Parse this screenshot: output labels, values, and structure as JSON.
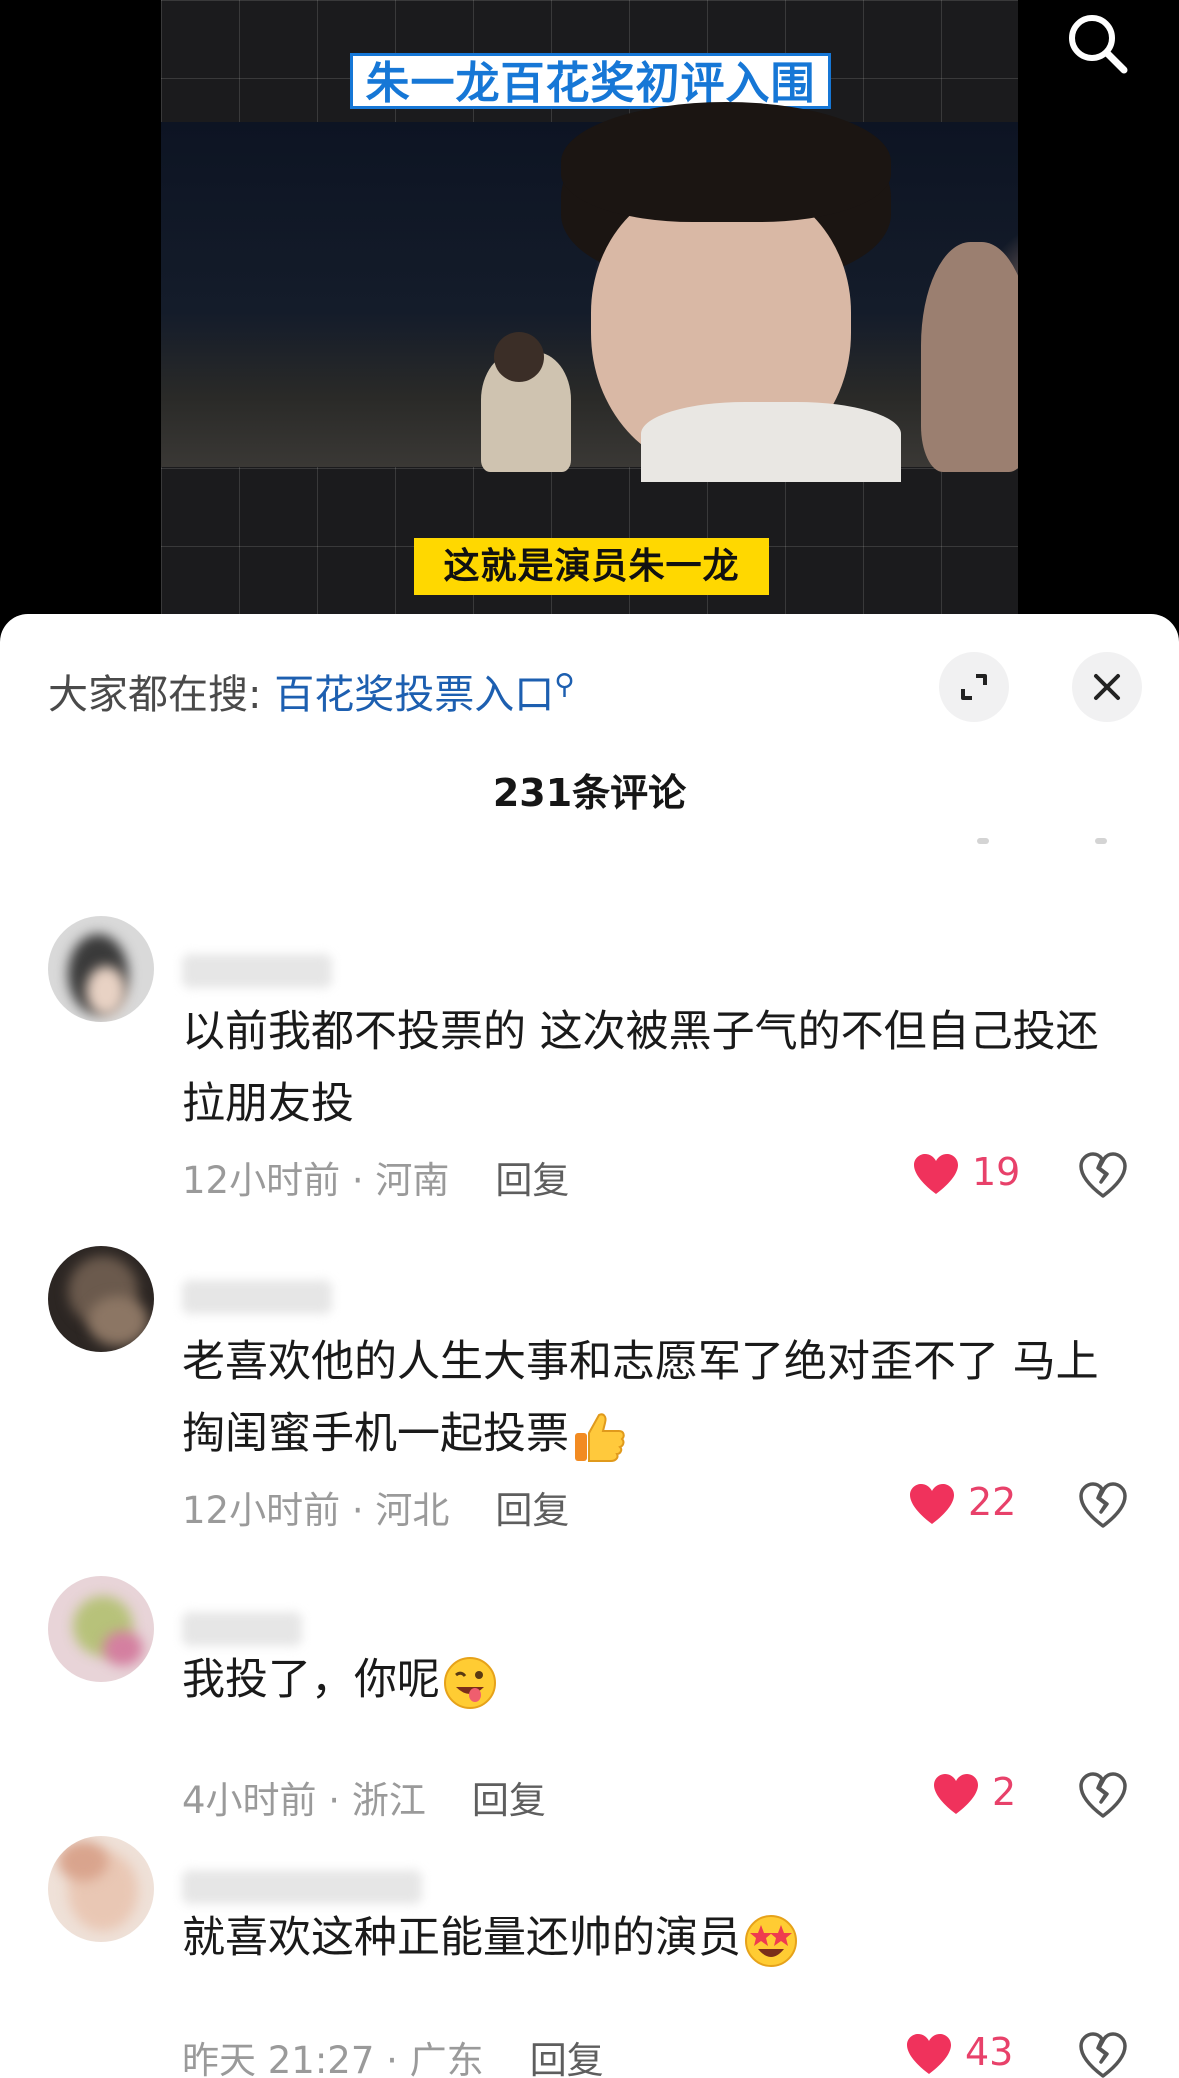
{
  "video": {
    "title_overlay": "朱一龙百花奖初评入围",
    "caption_overlay": "这就是演员朱一龙"
  },
  "top_bar": {
    "search_icon": "search-icon"
  },
  "sheet": {
    "trending_prefix": "大家都在搜:",
    "trending_query": "百花奖投票入口",
    "expand_icon": "expand-icon",
    "close_icon": "close-icon",
    "comment_count": "231条评论"
  },
  "comments": [
    {
      "text": "以前我都不投票的 这次被黑子气的不但自己投还拉朋友投",
      "time_location": "12小时前 · 河南",
      "reply_label": "回复",
      "likes": "19"
    },
    {
      "text": "老喜欢他的人生大事和志愿军了绝对歪不了 马上掏闺蜜手机一起投票",
      "emoji": "thumbs-up-emoji",
      "time_location": "12小时前 · 河北",
      "reply_label": "回复",
      "likes": "22"
    },
    {
      "text": "我投了，你呢",
      "emoji": "winking-tongue-emoji",
      "time_location": "4小时前 · 浙江",
      "reply_label": "回复",
      "likes": "2"
    },
    {
      "text": "就喜欢这种正能量还帅的演员",
      "emoji": "star-struck-emoji",
      "time_location": "昨天 21:27 · 广东",
      "reply_label": "回复",
      "likes": "43"
    }
  ],
  "colors": {
    "like_red": "#f0325c",
    "link_blue": "#1d5fb0",
    "caption_yellow": "#ffd800"
  }
}
